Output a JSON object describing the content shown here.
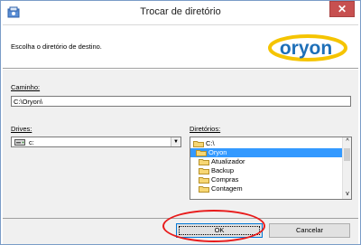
{
  "window": {
    "title": "Trocar de diretório",
    "close_icon": "close-icon"
  },
  "header": {
    "instruction": "Escolha o diretório de destino.",
    "logo_text": "oryon"
  },
  "path": {
    "label": "Caminho:",
    "value": "C:\\Oryon\\"
  },
  "drives": {
    "label": "Drives:",
    "selected": "c:"
  },
  "directories": {
    "label": "Diretórios:",
    "items": [
      {
        "label": "C:\\",
        "selected": false,
        "indent": 0
      },
      {
        "label": "Oryon",
        "selected": true,
        "indent": 1
      },
      {
        "label": "Atualizador",
        "selected": false,
        "indent": 2
      },
      {
        "label": "Backup",
        "selected": false,
        "indent": 2
      },
      {
        "label": "Compras",
        "selected": false,
        "indent": 2
      },
      {
        "label": "Contagem",
        "selected": false,
        "indent": 2
      }
    ]
  },
  "buttons": {
    "ok": "OK",
    "cancel": "Cancelar"
  },
  "colors": {
    "selection": "#3399ff",
    "highlight_ring": "#e81b1b",
    "logo_blue": "#1d6fb8",
    "logo_gold": "#f5c400"
  }
}
